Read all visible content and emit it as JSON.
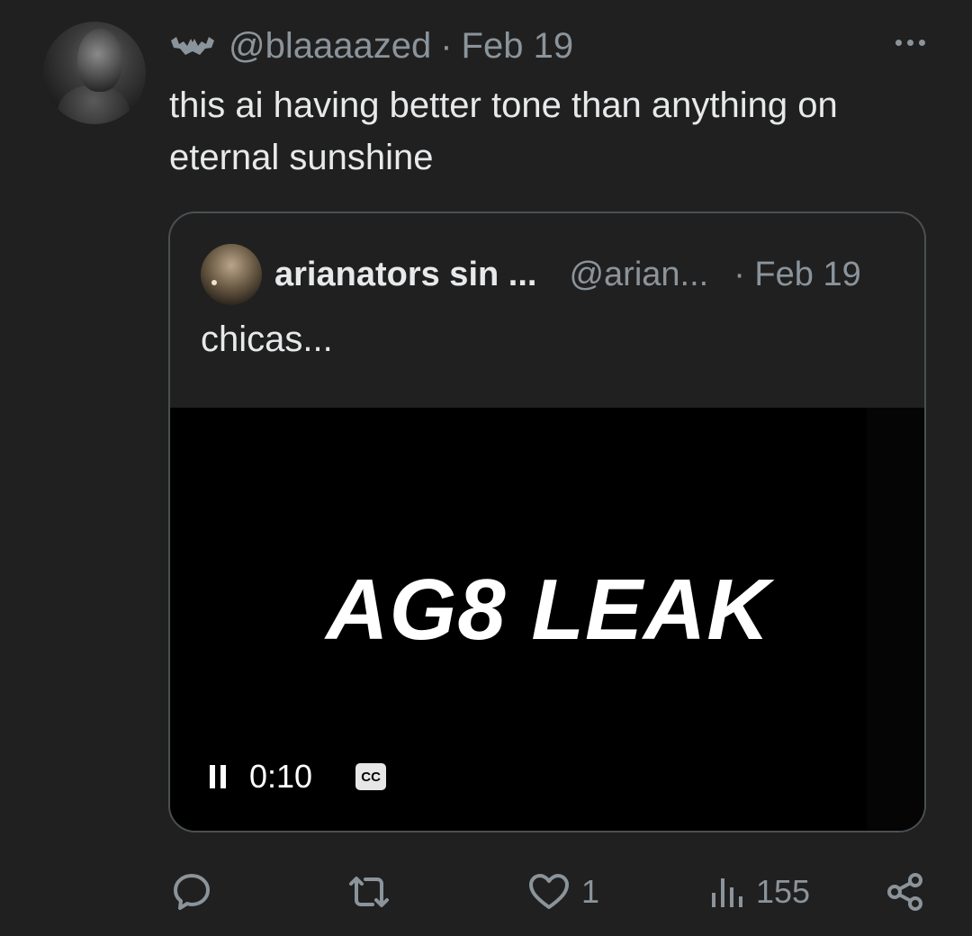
{
  "tweet": {
    "handle": "@blaaaazed",
    "separator": "·",
    "date": "Feb 19",
    "text": "this ai having better tone than anything on eternal sunshine",
    "author_icon": "bat-icon"
  },
  "quote": {
    "name": "arianators sin ...",
    "handle": "@arian...",
    "date": "· Feb 19",
    "text": "chicas...",
    "video": {
      "title": "AG8 LEAK",
      "time": "0:10",
      "cc_label": "CC"
    }
  },
  "actions": {
    "reply_icon": "reply-icon",
    "retweet_icon": "retweet-icon",
    "like_icon": "heart-icon",
    "like_count": "1",
    "views_icon": "views-icon",
    "views_count": "155",
    "share_icon": "share-icon"
  },
  "colors": {
    "background": "#202020",
    "text": "#e7e9ea",
    "muted": "#8b949b",
    "border": "#4a4f53"
  }
}
